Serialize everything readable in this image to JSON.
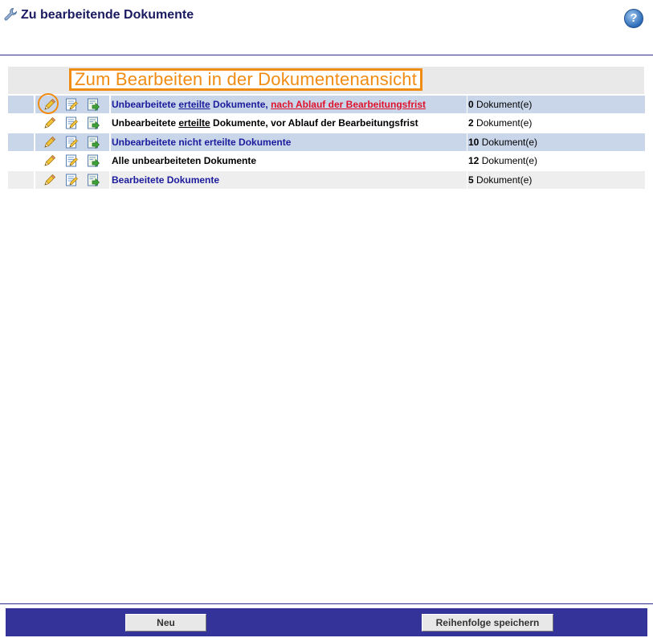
{
  "header": {
    "title": "Zu bearbeitende Dokumente",
    "help_label": "?"
  },
  "hint": {
    "text": "Zum Bearbeiten in der Dokumentenansicht"
  },
  "rows": [
    {
      "label_part1": "Unbearbeitete ",
      "label_link1": "erteilte",
      "label_part2": " Dokumente, ",
      "label_link2": "nach Ablauf der Bearbeitungsfrist",
      "count_number": "0",
      "count_unit": " Dokument(e)"
    },
    {
      "label_part1": "Unbearbeitete ",
      "label_link1": "erteilte",
      "label_part2": " Dokumente, vor Ablauf der Bearbeitungsfrist",
      "count_number": "2",
      "count_unit": " Dokument(e)"
    },
    {
      "label": "Unbearbeitete nicht erteilte Dokumente",
      "count_number": "10",
      "count_unit": " Dokument(e)"
    },
    {
      "label": "Alle unbearbeiteten Dokumente",
      "count_number": "12",
      "count_unit": " Dokument(e)"
    },
    {
      "label": "Bearbeitete Dokumente",
      "count_number": "5",
      "count_unit": " Dokument(e)"
    }
  ],
  "footer": {
    "new_label": "Neu",
    "save_order_label": "Reihenfolge speichern"
  },
  "colors": {
    "accent_orange": "#f08c12",
    "row_blue": "#c9d6ea",
    "row_grey": "#eeeeee",
    "link_blue": "#1b1b9c",
    "link_red": "#e0102a",
    "footer_bar": "#333399"
  },
  "icons": {
    "title": "wrench-icon",
    "help": "help-icon",
    "row_view": "pencil-icon",
    "row_edit": "edit-document-icon",
    "row_open": "open-document-icon"
  }
}
